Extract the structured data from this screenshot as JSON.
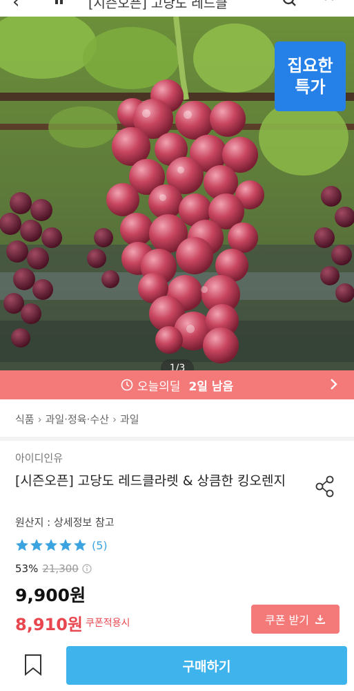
{
  "header": {
    "back_icon": "back-arrow-icon",
    "title": "[시즌오픈] 고당도 레드클",
    "icons": [
      "search-icon",
      "cart-icon"
    ]
  },
  "hero": {
    "badge_line1": "집요한",
    "badge_line2": "특가",
    "pager": "1/3",
    "badge_color": "#2580e8"
  },
  "deal": {
    "label": "오늘의딜",
    "remaining": "2일 남음",
    "color": "#f47a7a"
  },
  "breadcrumb": {
    "items": [
      "식품",
      "과일·정육·수산",
      "과일"
    ]
  },
  "product": {
    "seller": "아이디인유",
    "title": "[시즌오픈] 고당도 레드클라렛 & 상큼한 킹오렌지",
    "origin": "원산지 : 상세정보 참고",
    "rating_stars": 5,
    "review_count": "(5)",
    "discount_rate": "53%",
    "original_price": "21,300",
    "price": "9,900원",
    "coupon_price": "8,910원",
    "coupon_label": "쿠폰적용시"
  },
  "actions": {
    "coupon_button": "쿠폰 받기",
    "buy_button": "구매하기",
    "buy_color": "#3fb4ec",
    "coupon_color": "#f47a7a"
  }
}
